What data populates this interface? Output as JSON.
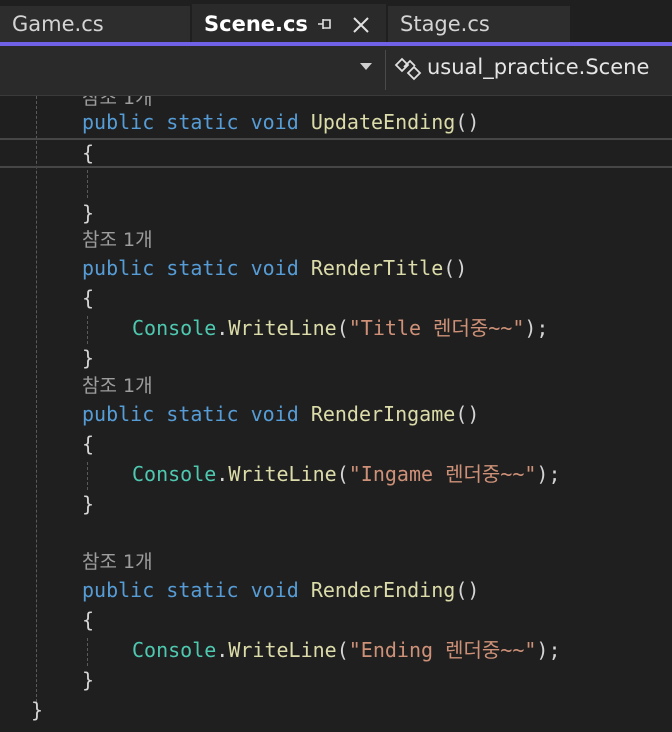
{
  "tabs": [
    {
      "label": "Game.cs",
      "active": false
    },
    {
      "label": "Scene.cs",
      "active": true,
      "pin_icon": "pin-icon",
      "close_icon": "close-icon"
    },
    {
      "label": "Stage.cs",
      "active": false
    }
  ],
  "navbar": {
    "member_dropdown_value": "",
    "class_icon": "class-icon",
    "class_label": "usual_practice.Scene"
  },
  "colors": {
    "accent": "#7160e8",
    "keyword": "#569cd6",
    "function": "#dcdcaa",
    "type": "#4ec9b0",
    "string": "#ce9178",
    "codelens": "#9d9d9d",
    "background": "#1f1f1f"
  },
  "code": {
    "codelens_text": "참조 1개",
    "kw_public": "public",
    "kw_static": "static",
    "kw_void": "void",
    "open_brace": "{",
    "close_brace": "}",
    "console_type": "Console",
    "dot": ".",
    "writeline": "WriteLine",
    "paren_open": "(",
    "call_end": ");",
    "empty_parens": "()",
    "methods": [
      {
        "name": "UpdateEnding",
        "body_string": ""
      },
      {
        "name": "RenderTitle",
        "body_string": "\"Title 렌더중~~\""
      },
      {
        "name": "RenderIngame",
        "body_string": "\"Ingame 렌더중~~\""
      },
      {
        "name": "RenderEnding",
        "body_string": "\"Ending 렌더중~~\""
      }
    ]
  }
}
